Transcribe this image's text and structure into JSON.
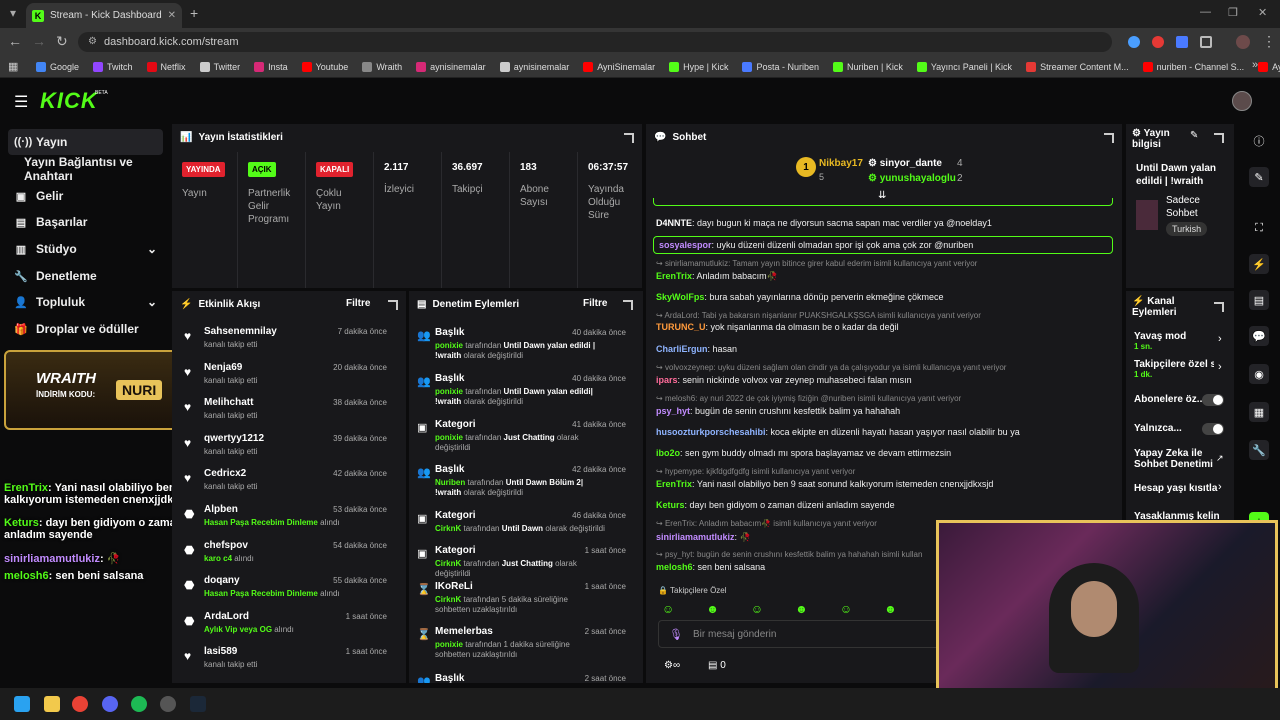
{
  "browser": {
    "tab_title": "Stream - Kick Dashboard",
    "url": "dashboard.kick.com/stream",
    "bookmarks": [
      "Google",
      "Twitch",
      "Netflix",
      "Twitter",
      "Insta",
      "Youtube",
      "Wraith",
      "aynisinemalar",
      "aynisinemalar",
      "AyniSinemalar",
      "Hype | Kick",
      "Posta - Nuriben",
      "Nuriben | Kick",
      "Yayıncı Paneli | Kick",
      "Streamer Content M...",
      "nuriben - Channel S...",
      "Aynı Sinemalar - Ça..."
    ]
  },
  "brand": {
    "logo": "KICK",
    "beta": "BETA",
    "accent": "#53fc18"
  },
  "sidebar": {
    "items": [
      {
        "label": "Yayın",
        "icon": "broadcast-icon"
      },
      {
        "label": "Yayın Bağlantısı ve Anahtarı"
      },
      {
        "label": "Gelir",
        "icon": "revenue-icon"
      },
      {
        "label": "Başarılar",
        "icon": "achievement-icon"
      },
      {
        "label": "Stüdyo",
        "icon": "studio-icon"
      },
      {
        "label": "Denetleme",
        "icon": "wrench-icon"
      },
      {
        "label": "Topluluk",
        "icon": "community-icon"
      },
      {
        "label": "Droplar ve ödüller",
        "icon": "drops-icon"
      }
    ]
  },
  "stats": {
    "title": "Yayın İstatistikleri",
    "yayin_badge": "YAYINDA",
    "yayin_label": "Yayın",
    "partner_badge": "AÇIK",
    "partner_label": "Partnerlik Gelir Programı",
    "multi_badge": "KAPALI",
    "multi_label": "Çoklu Yayın",
    "viewers": "2.117",
    "viewers_label": "İzleyici",
    "followers": "36.697",
    "followers_label": "Takipçi",
    "subs": "183",
    "subs_label": "Abone Sayısı",
    "duration": "06:37:57",
    "duration_label": "Yayında Olduğu Süre"
  },
  "activity": {
    "title": "Etkinlik Akışı",
    "filter": "Filtre",
    "items": [
      {
        "name": "Sahsenemnilay",
        "sub": "kanalı takip etti",
        "time": "7 dakika önce",
        "icon": "heart"
      },
      {
        "name": "Nenja69",
        "sub": "kanalı takip etti",
        "time": "20 dakika önce",
        "icon": "heart"
      },
      {
        "name": "Melihchatt",
        "sub": "kanalı takip etti",
        "time": "38 dakika önce",
        "icon": "heart"
      },
      {
        "name": "qwertyy1212",
        "sub": "kanalı takip etti",
        "time": "39 dakika önce",
        "icon": "heart"
      },
      {
        "name": "Cedricx2",
        "sub": "kanalı takip etti",
        "time": "42 dakika önce",
        "icon": "heart"
      },
      {
        "name": "Alpben",
        "sub_g": "Hasan Paşa Recebim Dinleme",
        "sub": "alındı",
        "time": "53 dakika önce",
        "icon": "drops"
      },
      {
        "name": "chefspov",
        "sub_g": "karo c4",
        "sub": "alındı",
        "time": "54 dakika önce",
        "icon": "drops"
      },
      {
        "name": "doqany",
        "sub_g": "Hasan Paşa Recebim Dinleme",
        "sub": "alındı",
        "time": "55 dakika önce",
        "icon": "drops"
      },
      {
        "name": "ArdaLord",
        "sub_g": "Aylık Vip veya OG",
        "sub": "alındı",
        "time": "1 saat önce",
        "icon": "drops"
      },
      {
        "name": "lasi589",
        "sub": "kanalı takip etti",
        "time": "1 saat önce",
        "icon": "heart"
      }
    ]
  },
  "mod": {
    "title": "Denetim Eylemleri",
    "filter": "Filtre",
    "items": [
      {
        "title": "Başlık",
        "user": "ponixie",
        "mid": "tarafından",
        "val": "Until Dawn yalan edildi | !wraith",
        "end": "olarak değiştirildi",
        "time": "40 dakika önce"
      },
      {
        "title": "Başlık",
        "user": "ponixie",
        "mid": "tarafından",
        "val": "Until Dawn yalan edildi| !wraith",
        "end": "olarak değiştirildi",
        "time": "40 dakika önce"
      },
      {
        "title": "Kategori",
        "user": "ponixie",
        "mid": "tarafından",
        "val": "Just Chatting",
        "end": "olarak değiştirildi",
        "time": "41 dakika önce"
      },
      {
        "title": "Başlık",
        "user": "Nuriben",
        "mid": "tarafından",
        "val": "Until Dawn Bölüm 2| !wraith",
        "end": "olarak değiştirildi",
        "time": "42 dakika önce"
      },
      {
        "title": "Kategori",
        "user": "CirknK",
        "mid": "tarafından",
        "val": "Until Dawn",
        "end": "olarak değiştirildi",
        "time": "46 dakika önce"
      },
      {
        "title": "Kategori",
        "user": "CirknK",
        "mid": "tarafından",
        "val": "Just Chatting",
        "end": "olarak değiştirildi",
        "time": "1 saat önce"
      },
      {
        "title": "IKoReLi",
        "user": "CirknK",
        "mid": "tarafından 5 dakika süreliğine sohbetten uzaklaştırıldı",
        "val": "",
        "end": "",
        "time": "1 saat önce"
      },
      {
        "title": "Memelerbas",
        "user": "ponixie",
        "mid": "tarafından 1 dakika süreliğine sohbetten uzaklaştırıldı",
        "val": "",
        "end": "",
        "time": "2 saat önce"
      },
      {
        "title": "Başlık",
        "user": "",
        "mid": "",
        "val": "",
        "end": "",
        "time": "2 saat önce"
      }
    ]
  },
  "chat": {
    "title": "Sohbet",
    "top1": "Nikbay17",
    "top1_count": "5",
    "top2": "sinyor_dante",
    "top2_count": "4",
    "top3": "yunushayaloglu",
    "top3_count": "2",
    "lines": [
      {
        "u": "D4NNTE",
        "c": "#ffffff",
        "t": "dayı bugun ki maça ne diyorsun sacma sapan mac verdiler ya @noelday1"
      },
      {
        "u": "sosyalespor",
        "c": "#c28cff",
        "t": "uyku düzeni düzenli olmadan spor işi çok ama çok zor @nuriben",
        "hl": true
      },
      {
        "sys": "sinirliamamutlukiz: Tamam yayın bitince girer kabul ederim isimli kullanıcıya yanıt veriyor"
      },
      {
        "u": "ErenTrix",
        "c": "#53fc18",
        "t": "Anladım babacım🥀"
      },
      {
        "u": "SkyWolFps",
        "c": "#53fc18",
        "t": "bura sabah yayınlarına dönüp perverin ekmeğine çökmece"
      },
      {
        "sys": "ArdaLord: Tabi ya bakarsın nişanlanır PUAKSHGALKŞSGA isimli kullanıcıya yanıt veriyor"
      },
      {
        "u": "TURUNC_U",
        "c": "#ff9a3c",
        "t": "yok nişanlanma da olmasın be o kadar da değil"
      },
      {
        "u": "CharliErgun",
        "c": "#8fb4ff",
        "t": "  hasan  "
      },
      {
        "sys": "volvoxzeynep: uyku düzeni sağlam olan cindir ya da çalışıyodur ya isimli kullanıcıya yanıt veriyor"
      },
      {
        "u": "ipars",
        "c": "#ff6b9a",
        "t": "senin nickinde volvox var zeynep muhasebeci falan mısın"
      },
      {
        "sys": "melosh6: ay nuri 2022 de çok iyiymiş fiziğin @nuriben isimli kullanıcıya yanıt veriyor"
      },
      {
        "u": "psy_hyt",
        "c": "#c28cff",
        "t": "bugün de senin crushını kesfettik balim ya hahahah"
      },
      {
        "u": "husoozturkporschesahibi",
        "c": "#8fb4ff",
        "t": "koca ekipte en düzenli hayatı hasan yaşıyor nasıl olabilir bu ya"
      },
      {
        "u": "ibo2o",
        "c": "#53fc18",
        "t": "sen gym buddy olmadı mı spora başlayamaz ve devam ettirmezsin"
      },
      {
        "sys": "hypemype: kjkfdgdfgdfg isimli kullanıcıya yanıt veriyor"
      },
      {
        "u": "ErenTrix",
        "c": "#53fc18",
        "t": "Yani nasıl olabiliyo ben 9 saat sonund kalkıyorum istemeden cnenxjjdkxsjd"
      },
      {
        "u": "Keturs",
        "c": "#53fc18",
        "t": "dayı ben gidiyom o zaman düzeni anladım sayende"
      },
      {
        "sys": "ErenTrix: Anladım babacım🥀 isimli kullanıcıya yanıt veriyor"
      },
      {
        "u": "sinirliamamutlukiz",
        "c": "#c28cff",
        "t": "🥀"
      },
      {
        "sys": "psy_hyt: bugün de senin crushını kesfettik balim ya hahahah isimli kullan"
      },
      {
        "u": "melosh6",
        "c": "#53fc18",
        "t": "sen beni salsana"
      }
    ],
    "followers_only": "Takipçilere Özel",
    "placeholder": "Bir mesaj gönderin",
    "count": "0"
  },
  "info": {
    "title": "Yayın bilgisi",
    "stream_title": "Until Dawn yalan edildi | !wraith",
    "mode": "Sadece Sohbet",
    "language": "Turkish"
  },
  "chatmod": {
    "title": "Kanal Eylemleri",
    "slow": "Yavaş mod",
    "slow_val": "1 sn.",
    "followers": "Takipçilere özel s",
    "followers_val": "1 dk.",
    "subs": "Abonelere öz...",
    "only": "Yalnızca...",
    "ai": "Yapay Zeka ile Sohbet Denetimi",
    "age": "Hesap yaşı kısıtla",
    "banned": "Yasaklanmış kelin"
  },
  "overlay": {
    "promo_brand": "WRAITH",
    "promo_code_label": "İNDİRİM KODU:",
    "promo_code": "NURI",
    "chat": [
      {
        "u": "ErenTrix",
        "t": "Yani nasıl olabiliyo ben 9 saat sonund kalkıyorum istemeden cnenxjjdkxsjd"
      },
      {
        "u": "Keturs",
        "t": "dayı ben gidiyom o zaman düzeni anladım sayende"
      },
      {
        "u": "sinirliamamutlukiz",
        "t": "🥀"
      },
      {
        "u": "melosh6",
        "t": "sen beni salsana"
      }
    ]
  }
}
